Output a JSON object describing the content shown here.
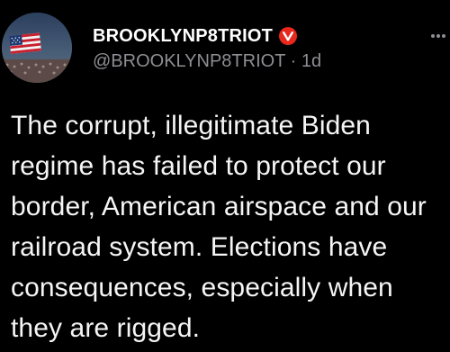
{
  "post": {
    "author": {
      "display_name": "BROOKLYNP8TRIOT",
      "handle": "@BROOKLYNP8TRIOT",
      "verified_badge_icon": "verified-check-icon",
      "badge_color": "#e8271d",
      "avatar_icon": "us-flag-stadium-avatar"
    },
    "separator": "·",
    "timestamp": "1d",
    "text": "The corrupt, illegitimate Biden regime has failed to protect our border, American airspace and our railroad system. Elections have consequences, especially when they are rigged."
  },
  "colors": {
    "background": "#000000",
    "text": "#ffffff",
    "muted": "#8e8e93"
  }
}
